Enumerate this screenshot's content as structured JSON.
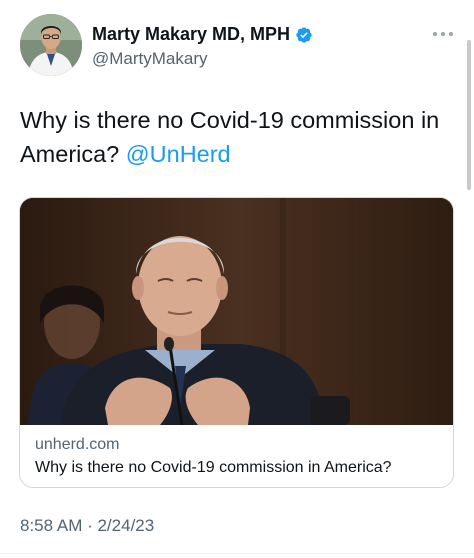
{
  "author": {
    "display_name": "Marty Makary MD, MPH",
    "handle": "@MartyMakary",
    "verified": true,
    "avatar_icon": "profile-photo"
  },
  "tweet": {
    "text": "Why is there no Covid-19 commission in America? ",
    "mention": "@UnHerd",
    "timestamp": "8:58 AM · 2/24/23"
  },
  "link_card": {
    "domain": "unherd.com",
    "title": "Why is there no Covid-19 commission in America?",
    "image": "photo-of-man-at-hearing-microphone"
  },
  "colors": {
    "accent": "#1d9bf0",
    "text": "#0f1419",
    "secondary_text": "#536471",
    "border": "#cfd9de"
  }
}
